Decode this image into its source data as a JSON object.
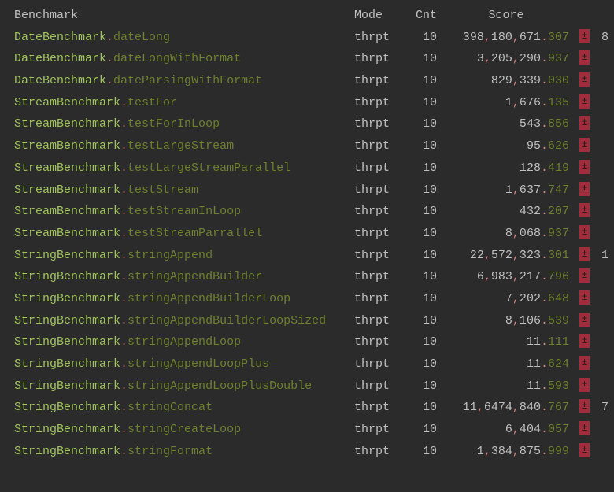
{
  "header": {
    "benchmark": "Benchmark",
    "mode": "Mode",
    "cnt": "Cnt",
    "score": "Score"
  },
  "plusminus": "±",
  "rows": [
    {
      "class": "DateBenchmark",
      "method": "dateLong",
      "mode": "thrpt",
      "cnt": "10",
      "score_int": "398,180,671",
      "score_dec": "307",
      "extra": "8"
    },
    {
      "class": "DateBenchmark",
      "method": "dateLongWithFormat",
      "mode": "thrpt",
      "cnt": "10",
      "score_int": "3,205,290",
      "score_dec": "937",
      "extra": ""
    },
    {
      "class": "DateBenchmark",
      "method": "dateParsingWithFormat",
      "mode": "thrpt",
      "cnt": "10",
      "score_int": "829,339",
      "score_dec": "030",
      "extra": ""
    },
    {
      "class": "StreamBenchmark",
      "method": "testFor",
      "mode": "thrpt",
      "cnt": "10",
      "score_int": "1,676",
      "score_dec": "135",
      "extra": ""
    },
    {
      "class": "StreamBenchmark",
      "method": "testForInLoop",
      "mode": "thrpt",
      "cnt": "10",
      "score_int": "543",
      "score_dec": "856",
      "extra": ""
    },
    {
      "class": "StreamBenchmark",
      "method": "testLargeStream",
      "mode": "thrpt",
      "cnt": "10",
      "score_int": "95",
      "score_dec": "626",
      "extra": ""
    },
    {
      "class": "StreamBenchmark",
      "method": "testLargeStreamParallel",
      "mode": "thrpt",
      "cnt": "10",
      "score_int": "128",
      "score_dec": "419",
      "extra": ""
    },
    {
      "class": "StreamBenchmark",
      "method": "testStream",
      "mode": "thrpt",
      "cnt": "10",
      "score_int": "1,637",
      "score_dec": "747",
      "extra": ""
    },
    {
      "class": "StreamBenchmark",
      "method": "testStreamInLoop",
      "mode": "thrpt",
      "cnt": "10",
      "score_int": "432",
      "score_dec": "207",
      "extra": ""
    },
    {
      "class": "StreamBenchmark",
      "method": "testStreamParrallel",
      "mode": "thrpt",
      "cnt": "10",
      "score_int": "8,068",
      "score_dec": "937",
      "extra": ""
    },
    {
      "class": "StringBenchmark",
      "method": "stringAppend",
      "mode": "thrpt",
      "cnt": "10",
      "score_int": "22,572,323",
      "score_dec": "301",
      "extra": "1"
    },
    {
      "class": "StringBenchmark",
      "method": "stringAppendBuilder",
      "mode": "thrpt",
      "cnt": "10",
      "score_int": "6,983,217",
      "score_dec": "796",
      "extra": ""
    },
    {
      "class": "StringBenchmark",
      "method": "stringAppendBuilderLoop",
      "mode": "thrpt",
      "cnt": "10",
      "score_int": "7,202",
      "score_dec": "648",
      "extra": ""
    },
    {
      "class": "StringBenchmark",
      "method": "stringAppendBuilderLoopSized",
      "mode": "thrpt",
      "cnt": "10",
      "score_int": "8,106",
      "score_dec": "539",
      "extra": ""
    },
    {
      "class": "StringBenchmark",
      "method": "stringAppendLoop",
      "mode": "thrpt",
      "cnt": "10",
      "score_int": "11",
      "score_dec": "111",
      "extra": ""
    },
    {
      "class": "StringBenchmark",
      "method": "stringAppendLoopPlus",
      "mode": "thrpt",
      "cnt": "10",
      "score_int": "11",
      "score_dec": "624",
      "extra": ""
    },
    {
      "class": "StringBenchmark",
      "method": "stringAppendLoopPlusDouble",
      "mode": "thrpt",
      "cnt": "10",
      "score_int": "11",
      "score_dec": "593",
      "extra": ""
    },
    {
      "class": "StringBenchmark",
      "method": "stringConcat",
      "mode": "thrpt",
      "cnt": "10",
      "score_int": "11,6474,840",
      "score_dec": "767",
      "extra": "7"
    },
    {
      "class": "StringBenchmark",
      "method": "stringCreateLoop",
      "mode": "thrpt",
      "cnt": "10",
      "score_int": "6,404",
      "score_dec": "057",
      "extra": ""
    },
    {
      "class": "StringBenchmark",
      "method": "stringFormat",
      "mode": "thrpt",
      "cnt": "10",
      "score_int": "1,384,875",
      "score_dec": "999",
      "extra": ""
    }
  ]
}
